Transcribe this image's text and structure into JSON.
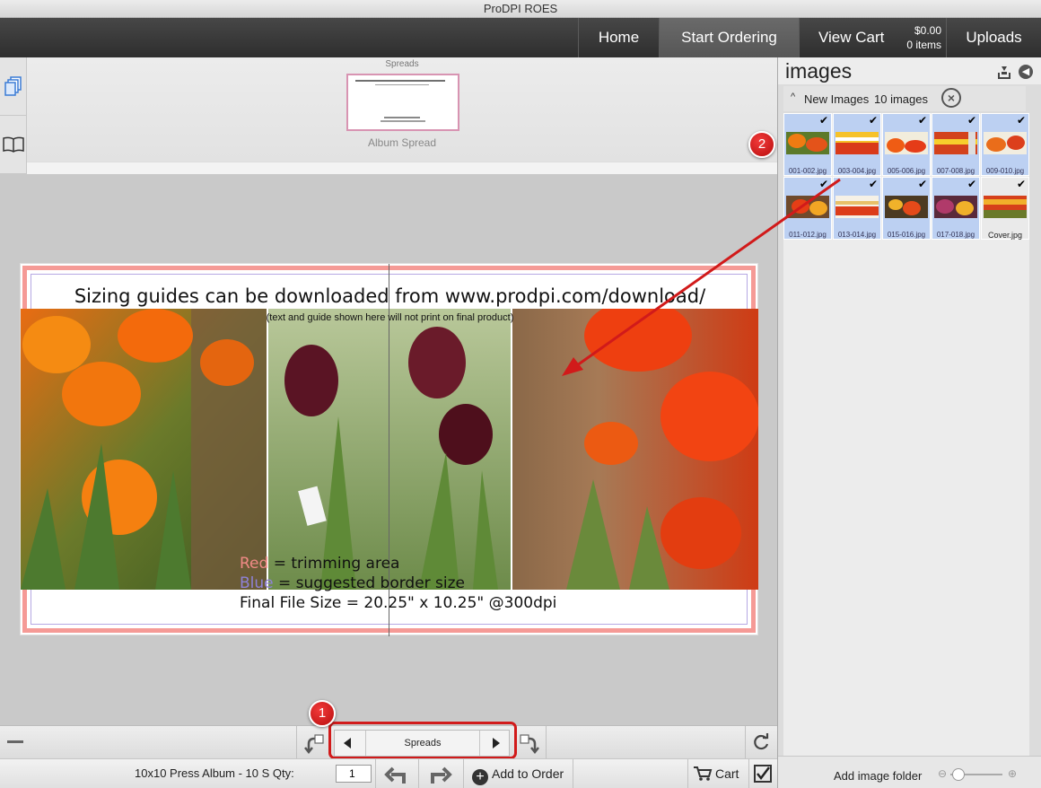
{
  "window": {
    "title": "ProDPI ROES"
  },
  "nav": {
    "home": "Home",
    "start_ordering": "Start Ordering",
    "view_cart": "View Cart",
    "cart_total": "$0.00",
    "cart_items": "0 items",
    "uploads": "Uploads"
  },
  "spreads_strip": {
    "title": "Spreads",
    "thumb_label": "Album Spread"
  },
  "canvas": {
    "guide_title": "Sizing guides can be downloaded from www.prodpi.com/download/",
    "guide_sub": "(text and guide shown here will not print on final product)",
    "legend_red_word": "Red",
    "legend_red_rest": " = trimming area",
    "legend_blue_word": "Blue",
    "legend_blue_rest": " = suggested border size",
    "final_size": "Final File Size = 20.25\" x 10.25\" @300dpi"
  },
  "bottom_nav": {
    "label": "Spreads"
  },
  "order_bar": {
    "product": "10x10 Press Album - 10 S Qty:",
    "qty": "1",
    "add_to_order": "Add to Order",
    "cart": "Cart"
  },
  "images_panel": {
    "title": "images",
    "section_label": "New Images",
    "count": "10 images",
    "images": [
      {
        "name": "001-002.jpg"
      },
      {
        "name": "003-004.jpg"
      },
      {
        "name": "005-006.jpg"
      },
      {
        "name": "007-008.jpg"
      },
      {
        "name": "009-010.jpg"
      },
      {
        "name": "011-012.jpg"
      },
      {
        "name": "013-014.jpg"
      },
      {
        "name": "015-016.jpg"
      },
      {
        "name": "017-018.jpg"
      },
      {
        "name": "Cover.jpg"
      }
    ],
    "add_folder": "Add image folder"
  },
  "callouts": {
    "one": "1",
    "two": "2"
  },
  "colors": {
    "trim": "#f59a96",
    "border_guide": "#b6a8e3",
    "callout": "#d11a1a",
    "selected_thumb": "#bcd0f2"
  }
}
